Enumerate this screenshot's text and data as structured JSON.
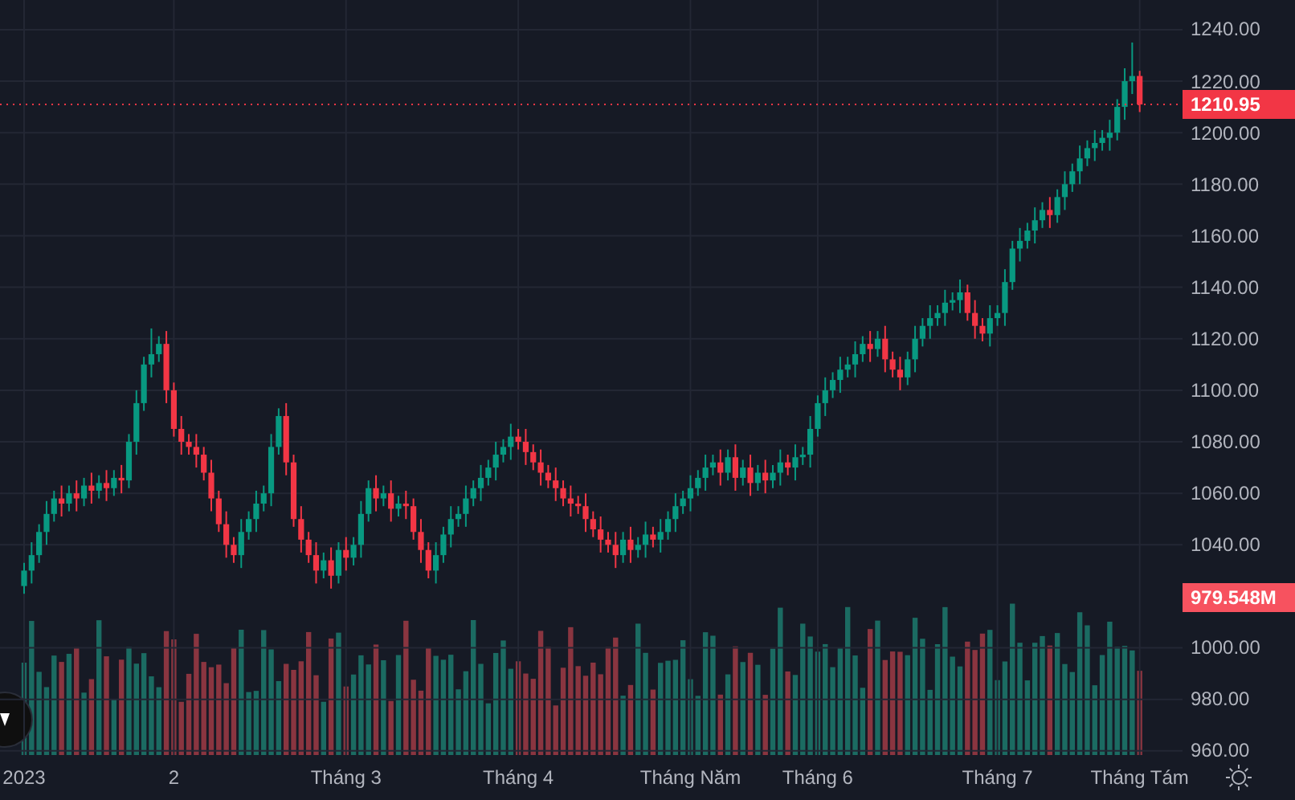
{
  "chart_data": {
    "type": "candlestick",
    "categories": [
      "2023",
      null,
      null,
      null,
      null,
      null,
      null,
      null,
      null,
      null,
      null,
      null,
      null,
      null,
      null,
      null,
      null,
      null,
      null,
      null,
      "2",
      null,
      null,
      null,
      null,
      null,
      null,
      null,
      null,
      null,
      null,
      null,
      null,
      null,
      null,
      null,
      null,
      null,
      null,
      null,
      null,
      null,
      null,
      "Tháng 3",
      null,
      null,
      null,
      null,
      null,
      null,
      null,
      null,
      null,
      null,
      null,
      null,
      null,
      null,
      null,
      null,
      null,
      null,
      null,
      null,
      null,
      null,
      "Tháng 4",
      null,
      null,
      null,
      null,
      null,
      null,
      null,
      null,
      null,
      null,
      null,
      null,
      null,
      null,
      null,
      null,
      null,
      null,
      null,
      null,
      null,
      null,
      "Tháng Năm",
      null,
      null,
      null,
      null,
      null,
      null,
      null,
      null,
      null,
      null,
      null,
      null,
      null,
      null,
      null,
      null,
      "Tháng 6",
      null,
      null,
      null,
      null,
      null,
      null,
      null,
      null,
      null,
      null,
      null,
      null,
      null,
      null,
      null,
      null,
      null,
      null,
      null,
      null,
      null,
      null,
      null,
      "Tháng 7",
      null,
      null,
      null,
      null,
      null,
      null,
      null,
      null,
      null,
      null,
      null,
      null,
      null,
      null,
      null,
      null,
      null,
      null,
      "Tháng Tám"
    ],
    "ohlc": [
      [
        1024,
        1033,
        1021,
        1030
      ],
      [
        1030,
        1041,
        1025,
        1036
      ],
      [
        1036,
        1048,
        1033,
        1045
      ],
      [
        1045,
        1057,
        1040,
        1052
      ],
      [
        1052,
        1061,
        1049,
        1058
      ],
      [
        1058,
        1063,
        1051,
        1056
      ],
      [
        1056,
        1063,
        1053,
        1060
      ],
      [
        1060,
        1065,
        1053,
        1058
      ],
      [
        1058,
        1066,
        1055,
        1063
      ],
      [
        1063,
        1068,
        1056,
        1061
      ],
      [
        1061,
        1067,
        1058,
        1064
      ],
      [
        1064,
        1069,
        1057,
        1062
      ],
      [
        1062,
        1069,
        1059,
        1066
      ],
      [
        1066,
        1071,
        1060,
        1065
      ],
      [
        1065,
        1083,
        1062,
        1080
      ],
      [
        1080,
        1100,
        1075,
        1095
      ],
      [
        1095,
        1113,
        1092,
        1110
      ],
      [
        1110,
        1124,
        1105,
        1114
      ],
      [
        1114,
        1121,
        1111,
        1118
      ],
      [
        1118,
        1123,
        1095,
        1100
      ],
      [
        1100,
        1103,
        1082,
        1085
      ],
      [
        1085,
        1090,
        1075,
        1080
      ],
      [
        1080,
        1083,
        1075,
        1078
      ],
      [
        1078,
        1083,
        1070,
        1075
      ],
      [
        1075,
        1078,
        1065,
        1068
      ],
      [
        1068,
        1073,
        1053,
        1058
      ],
      [
        1058,
        1061,
        1045,
        1048
      ],
      [
        1048,
        1053,
        1035,
        1040
      ],
      [
        1040,
        1043,
        1033,
        1036
      ],
      [
        1036,
        1050,
        1031,
        1045
      ],
      [
        1045,
        1053,
        1042,
        1050
      ],
      [
        1050,
        1061,
        1045,
        1056
      ],
      [
        1056,
        1063,
        1053,
        1060
      ],
      [
        1060,
        1083,
        1055,
        1078
      ],
      [
        1078,
        1093,
        1075,
        1090
      ],
      [
        1090,
        1095,
        1067,
        1072
      ],
      [
        1072,
        1075,
        1047,
        1050
      ],
      [
        1050,
        1055,
        1037,
        1042
      ],
      [
        1042,
        1045,
        1033,
        1036
      ],
      [
        1036,
        1041,
        1025,
        1030
      ],
      [
        1030,
        1037,
        1027,
        1034
      ],
      [
        1034,
        1039,
        1023,
        1028
      ],
      [
        1028,
        1041,
        1025,
        1038
      ],
      [
        1038,
        1043,
        1030,
        1035
      ],
      [
        1035,
        1043,
        1032,
        1040
      ],
      [
        1040,
        1057,
        1035,
        1052
      ],
      [
        1052,
        1065,
        1049,
        1062
      ],
      [
        1062,
        1067,
        1053,
        1058
      ],
      [
        1058,
        1063,
        1055,
        1060
      ],
      [
        1060,
        1065,
        1049,
        1054
      ],
      [
        1054,
        1059,
        1051,
        1056
      ],
      [
        1056,
        1061,
        1050,
        1055
      ],
      [
        1055,
        1058,
        1042,
        1045
      ],
      [
        1045,
        1050,
        1033,
        1038
      ],
      [
        1038,
        1041,
        1027,
        1030
      ],
      [
        1030,
        1041,
        1025,
        1036
      ],
      [
        1036,
        1047,
        1033,
        1044
      ],
      [
        1044,
        1055,
        1039,
        1050
      ],
      [
        1050,
        1055,
        1047,
        1052
      ],
      [
        1052,
        1063,
        1047,
        1058
      ],
      [
        1058,
        1065,
        1055,
        1062
      ],
      [
        1062,
        1071,
        1057,
        1066
      ],
      [
        1066,
        1073,
        1063,
        1070
      ],
      [
        1070,
        1080,
        1065,
        1075
      ],
      [
        1075,
        1081,
        1072,
        1078
      ],
      [
        1078,
        1087,
        1073,
        1082
      ],
      [
        1082,
        1085,
        1077,
        1080
      ],
      [
        1080,
        1085,
        1071,
        1076
      ],
      [
        1076,
        1079,
        1069,
        1072
      ],
      [
        1072,
        1077,
        1063,
        1068
      ],
      [
        1068,
        1071,
        1062,
        1065
      ],
      [
        1065,
        1070,
        1057,
        1062
      ],
      [
        1062,
        1065,
        1055,
        1058
      ],
      [
        1058,
        1063,
        1051,
        1056
      ],
      [
        1056,
        1059,
        1052,
        1055
      ],
      [
        1055,
        1060,
        1045,
        1050
      ],
      [
        1050,
        1053,
        1043,
        1046
      ],
      [
        1046,
        1051,
        1037,
        1042
      ],
      [
        1042,
        1045,
        1037,
        1040
      ],
      [
        1040,
        1045,
        1031,
        1036
      ],
      [
        1036,
        1045,
        1033,
        1042
      ],
      [
        1042,
        1047,
        1033,
        1038
      ],
      [
        1038,
        1043,
        1035,
        1040
      ],
      [
        1040,
        1049,
        1035,
        1044
      ],
      [
        1044,
        1047,
        1039,
        1042
      ],
      [
        1042,
        1050,
        1037,
        1045
      ],
      [
        1045,
        1053,
        1042,
        1050
      ],
      [
        1050,
        1060,
        1045,
        1055
      ],
      [
        1055,
        1061,
        1052,
        1058
      ],
      [
        1058,
        1067,
        1053,
        1062
      ],
      [
        1062,
        1069,
        1059,
        1066
      ],
      [
        1066,
        1075,
        1061,
        1070
      ],
      [
        1070,
        1075,
        1067,
        1072
      ],
      [
        1072,
        1077,
        1063,
        1068
      ],
      [
        1068,
        1077,
        1065,
        1074
      ],
      [
        1074,
        1079,
        1061,
        1066
      ],
      [
        1066,
        1073,
        1063,
        1070
      ],
      [
        1070,
        1075,
        1059,
        1064
      ],
      [
        1064,
        1071,
        1061,
        1068
      ],
      [
        1068,
        1073,
        1060,
        1065
      ],
      [
        1065,
        1071,
        1062,
        1068
      ],
      [
        1068,
        1077,
        1063,
        1072
      ],
      [
        1072,
        1075,
        1067,
        1070
      ],
      [
        1070,
        1079,
        1065,
        1074
      ],
      [
        1074,
        1078,
        1071,
        1075
      ],
      [
        1075,
        1090,
        1070,
        1085
      ],
      [
        1085,
        1098,
        1082,
        1095
      ],
      [
        1095,
        1105,
        1090,
        1100
      ],
      [
        1100,
        1107,
        1097,
        1104
      ],
      [
        1104,
        1113,
        1099,
        1108
      ],
      [
        1108,
        1113,
        1105,
        1110
      ],
      [
        1110,
        1119,
        1105,
        1114
      ],
      [
        1114,
        1121,
        1111,
        1118
      ],
      [
        1118,
        1123,
        1111,
        1116
      ],
      [
        1116,
        1123,
        1113,
        1120
      ],
      [
        1120,
        1125,
        1107,
        1112
      ],
      [
        1112,
        1115,
        1105,
        1108
      ],
      [
        1108,
        1113,
        1100,
        1105
      ],
      [
        1105,
        1115,
        1102,
        1112
      ],
      [
        1112,
        1125,
        1107,
        1120
      ],
      [
        1120,
        1128,
        1117,
        1125
      ],
      [
        1125,
        1133,
        1120,
        1128
      ],
      [
        1128,
        1133,
        1125,
        1130
      ],
      [
        1130,
        1139,
        1125,
        1134
      ],
      [
        1134,
        1138,
        1131,
        1135
      ],
      [
        1135,
        1143,
        1130,
        1138
      ],
      [
        1138,
        1141,
        1127,
        1130
      ],
      [
        1130,
        1135,
        1120,
        1125
      ],
      [
        1125,
        1128,
        1119,
        1122
      ],
      [
        1122,
        1133,
        1117,
        1128
      ],
      [
        1128,
        1133,
        1125,
        1130
      ],
      [
        1130,
        1147,
        1125,
        1142
      ],
      [
        1142,
        1158,
        1139,
        1155
      ],
      [
        1155,
        1163,
        1150,
        1158
      ],
      [
        1158,
        1165,
        1155,
        1162
      ],
      [
        1162,
        1171,
        1157,
        1166
      ],
      [
        1166,
        1173,
        1163,
        1170
      ],
      [
        1170,
        1175,
        1163,
        1168
      ],
      [
        1168,
        1178,
        1165,
        1175
      ],
      [
        1175,
        1185,
        1170,
        1180
      ],
      [
        1180,
        1188,
        1177,
        1185
      ],
      [
        1185,
        1195,
        1180,
        1190
      ],
      [
        1190,
        1197,
        1187,
        1194
      ],
      [
        1194,
        1201,
        1189,
        1196
      ],
      [
        1196,
        1201,
        1193,
        1198
      ],
      [
        1198,
        1205,
        1193,
        1200
      ],
      [
        1200,
        1213,
        1197,
        1210
      ],
      [
        1210,
        1225,
        1205,
        1220
      ],
      [
        1220,
        1235,
        1215,
        1222
      ],
      [
        1222,
        1224,
        1208,
        1210.95
      ]
    ],
    "ylim": [
      958.4,
      1251.5
    ],
    "yticks": [
      {
        "value": 1240,
        "label": "1240.00"
      },
      {
        "value": 1220,
        "label": "1220.00"
      },
      {
        "value": 1200,
        "label": "1200.00"
      },
      {
        "value": 1180,
        "label": "1180.00"
      },
      {
        "value": 1160,
        "label": "1160.00"
      },
      {
        "value": 1140,
        "label": "1140.00"
      },
      {
        "value": 1120,
        "label": "1120.00"
      },
      {
        "value": 1100,
        "label": "1100.00"
      },
      {
        "value": 1080,
        "label": "1080.00"
      },
      {
        "value": 1060,
        "label": "1060.00"
      },
      {
        "value": 1040,
        "label": "1040.00"
      },
      {
        "value": 1000,
        "label": "1000.00"
      },
      {
        "value": 980,
        "label": "980.00"
      },
      {
        "value": 960,
        "label": "960.00"
      }
    ],
    "grid": true,
    "ref_lines": [
      {
        "axis": "y",
        "value": 1210.95,
        "label": "1210.95",
        "color": "#f23645"
      }
    ]
  },
  "volume_tag": "979.548M"
}
